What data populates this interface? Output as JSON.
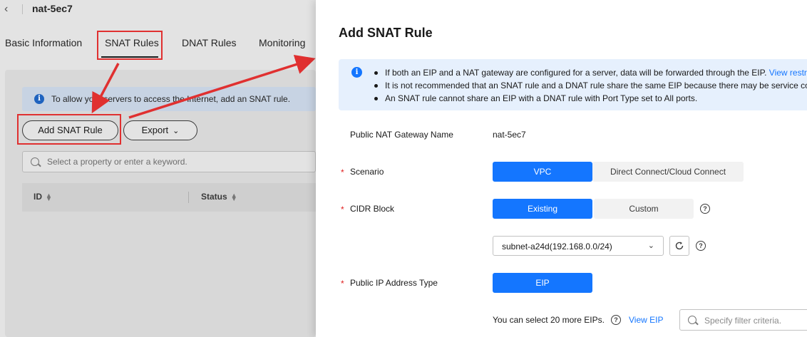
{
  "header": {
    "back_icon": "chevron-left-icon",
    "title": "nat-5ec7"
  },
  "tabs": [
    {
      "label": "Basic Information"
    },
    {
      "label": "SNAT Rules",
      "active": true
    },
    {
      "label": "DNAT Rules"
    },
    {
      "label": "Monitoring"
    }
  ],
  "notice": {
    "text": "To allow your servers to access the Internet, add an SNAT rule."
  },
  "toolbar": {
    "add_label": "Add SNAT Rule",
    "export_label": "Export"
  },
  "search": {
    "placeholder": "Select a property or enter a keyword."
  },
  "table": {
    "columns": [
      "ID",
      "Status"
    ]
  },
  "drawer": {
    "title": "Add SNAT Rule",
    "info": {
      "items": [
        "If both an EIP and a NAT gateway are configured for a server, data will be forwarded through the EIP.",
        "It is not recommended that an SNAT rule and a DNAT rule share the same EIP because there may be service co",
        "An SNAT rule cannot share an EIP with a DNAT rule with Port Type set to All ports."
      ],
      "link": "View restr"
    },
    "form": {
      "gateway_label": "Public NAT Gateway Name",
      "gateway_value": "nat-5ec7",
      "scenario_label": "Scenario",
      "scenario_options": [
        "VPC",
        "Direct Connect/Cloud Connect"
      ],
      "scenario_selected": "VPC",
      "cidr_label": "CIDR Block",
      "cidr_options": [
        "Existing",
        "Custom"
      ],
      "cidr_selected": "Existing",
      "subnet_value": "subnet-a24d(192.168.0.0/24)",
      "ip_type_label": "Public IP Address Type",
      "ip_type_option": "EIP",
      "eip_note": "You can select 20 more EIPs.",
      "view_eip_label": "View EIP",
      "filter_placeholder": "Specify filter criteria."
    }
  },
  "colors": {
    "primary": "#1476ff",
    "highlight": "#e03030",
    "required": "#e02020"
  }
}
